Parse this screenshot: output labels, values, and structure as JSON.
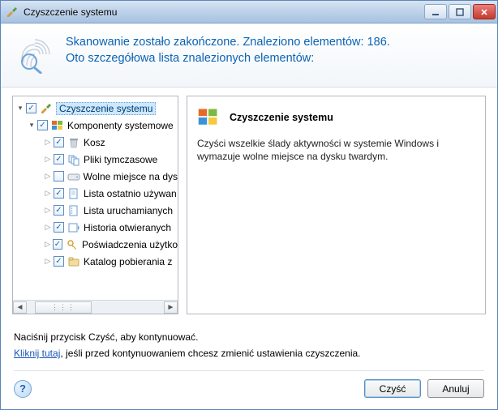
{
  "window": {
    "title": "Czyszczenie systemu"
  },
  "header": {
    "line1": "Skanowanie zostało zakończone. Znaleziono elementów: 186.",
    "line2": "Oto szczegółowa lista znalezionych elementów:"
  },
  "tree": {
    "root": {
      "label": "Czyszczenie systemu"
    },
    "group1": {
      "label": "Komponenty systemowe"
    },
    "items": [
      {
        "label": "Kosz"
      },
      {
        "label": "Pliki tymczasowe"
      },
      {
        "label": "Wolne miejsce na dys"
      },
      {
        "label": "Lista ostatnio używan"
      },
      {
        "label": "Lista uruchamianych"
      },
      {
        "label": "Historia otwieranych"
      },
      {
        "label": "Poświadczenia użytko"
      },
      {
        "label": "Katalog pobierania z"
      }
    ]
  },
  "description": {
    "title": "Czyszczenie systemu",
    "body": "Czyści wszelkie ślady aktywności w systemie Windows i wymazuje wolne miejsce na dysku twardym."
  },
  "footer": {
    "hint": "Naciśnij przycisk Czyść, aby kontynuować.",
    "link_text": "Kliknij tutaj",
    "link_rest": ", jeśli przed kontynuowaniem chcesz zmienić ustawienia czyszczenia.",
    "clean_label": "Czyść",
    "cancel_label": "Anuluj"
  }
}
